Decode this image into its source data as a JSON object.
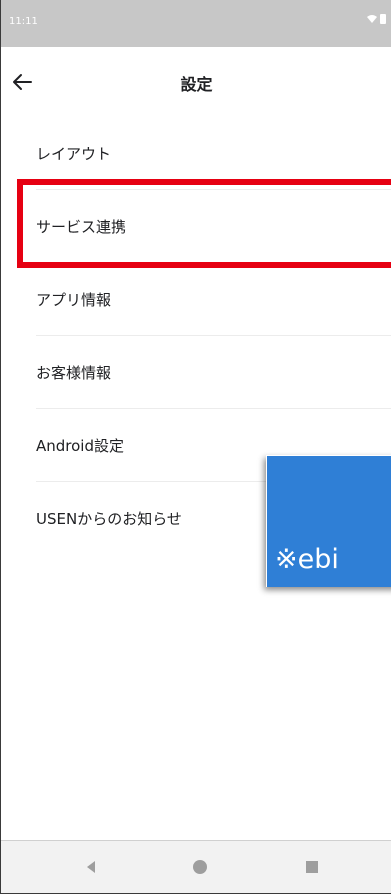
{
  "status_bar": {
    "time": "11:11",
    "icons": [
      "wifi-icon",
      "battery-icon"
    ]
  },
  "app_bar": {
    "back_icon": "arrow-left-icon",
    "title": "設定"
  },
  "menu": {
    "items": [
      {
        "label": "レイアウト"
      },
      {
        "label": "サービス連携",
        "highlighted": true
      },
      {
        "label": "アプリ情報"
      },
      {
        "label": "お客様情報"
      },
      {
        "label": "Android設定"
      },
      {
        "label": "USENからのお知らせ"
      }
    ]
  },
  "overlay": {
    "text": "※ebi"
  },
  "nav_bar": {
    "icons": [
      "nav-back-icon",
      "nav-home-icon",
      "nav-recents-icon"
    ]
  },
  "colors": {
    "highlight": "#e60012",
    "overlay": "#2f7fd6",
    "status_bar": "#c7c7c7",
    "nav_bar": "#f2f2f2"
  }
}
